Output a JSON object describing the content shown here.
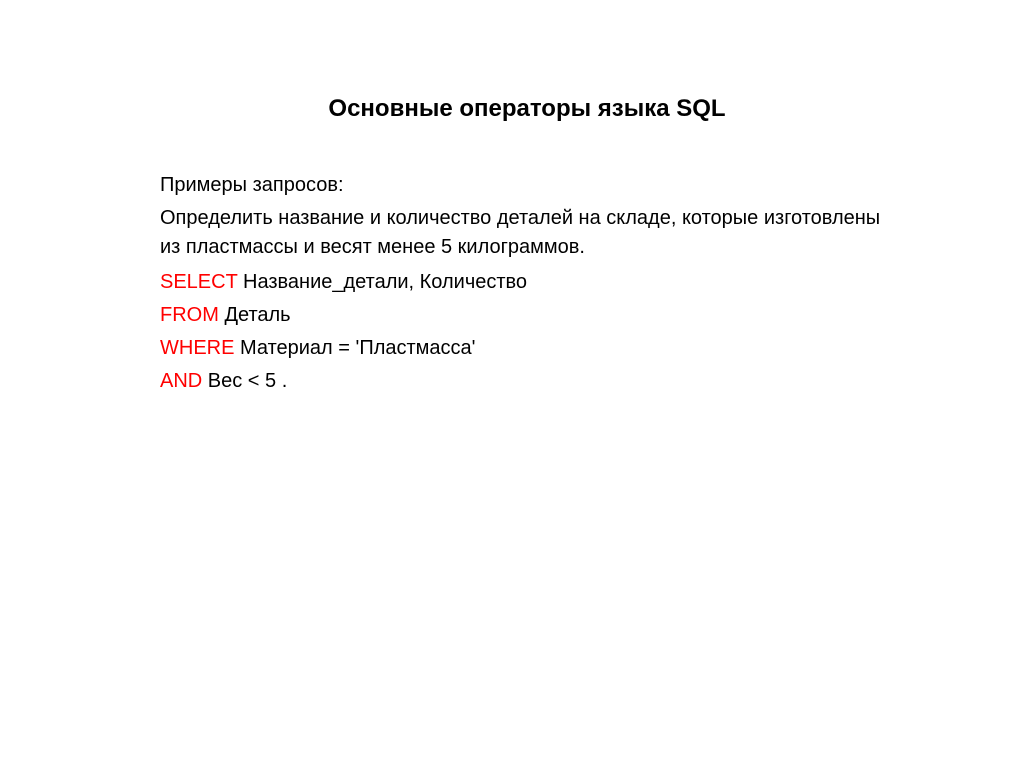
{
  "title": "Основные операторы языка SQL",
  "intro": "Примеры запросов:",
  "description": "Определить название и количество деталей на складе, которые изготовлены из пластмассы и весят менее 5 килограммов.",
  "sql": {
    "line1": {
      "kw": "SELECT",
      "rest": " Название_детали, Количество"
    },
    "line2": {
      "kw": "FROM",
      "rest": " Деталь"
    },
    "line3": {
      "kw": "WHERE",
      "rest": " Материал = 'Пластмасса'"
    },
    "line4": {
      "kw": "AND",
      "rest": " Вес < 5 ."
    }
  }
}
